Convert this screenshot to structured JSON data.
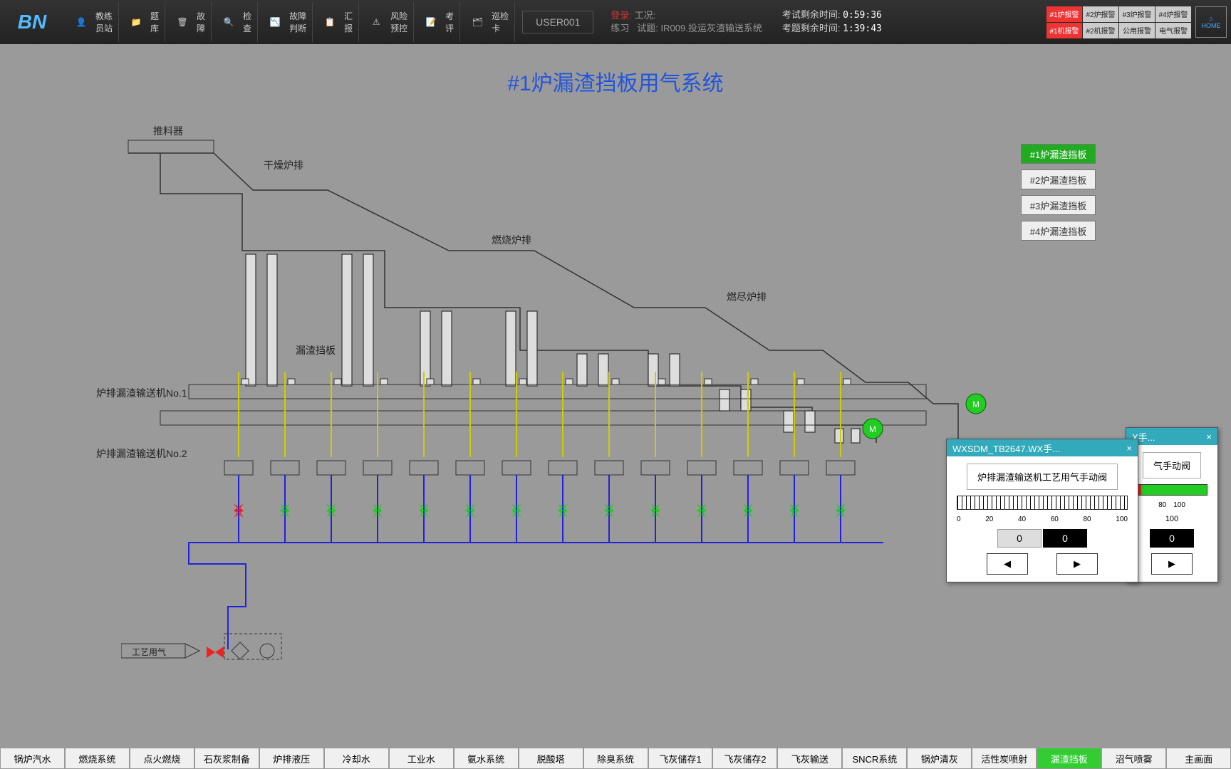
{
  "toolbar": {
    "logo": "BN",
    "buttons": [
      {
        "l1": "教练",
        "l2": "员站"
      },
      {
        "l1": "题",
        "l2": "库"
      },
      {
        "l1": "故",
        "l2": "障"
      },
      {
        "l1": "检",
        "l2": "查"
      },
      {
        "l1": "故障",
        "l2": "判断"
      },
      {
        "l1": "汇",
        "l2": "报"
      },
      {
        "l1": "风险",
        "l2": "预控"
      },
      {
        "l1": "考",
        "l2": "评"
      },
      {
        "l1": "巡检",
        "l2": "卡"
      }
    ],
    "user": "USER001",
    "info": {
      "line1_label": "登录:",
      "line1_val": "练习",
      "line2_label": "工况:",
      "line2_val": "",
      "line3_label": "试题:",
      "line3_val": "IR009.投运灰渣输送系统"
    },
    "timers": {
      "t1_label": "考试剩余时间:",
      "t1_val": "0:59:36",
      "t2_label": "考题剩余时间:",
      "t2_val": "1:39:43"
    },
    "alarms": [
      [
        "#1炉报警",
        "#2炉报警",
        "#3炉报警",
        "#4炉报警"
      ],
      [
        "#1机报警",
        "#2机报警",
        "公用报警",
        "电气报警"
      ]
    ],
    "alarm_red": [
      [
        true,
        false,
        false,
        false
      ],
      [
        true,
        false,
        false,
        false
      ]
    ],
    "home": "HOME"
  },
  "main": {
    "title": "#1炉漏渣挡板用气系统",
    "side_buttons": [
      {
        "label": "#1炉漏渣挡板",
        "active": true
      },
      {
        "label": "#2炉漏渣挡板",
        "active": false
      },
      {
        "label": "#3炉漏渣挡板",
        "active": false
      },
      {
        "label": "#4炉漏渣挡板",
        "active": false
      }
    ],
    "labels": {
      "pusher": "推料器",
      "dry_grate": "干燥炉排",
      "burn_grate": "燃烧炉排",
      "burnout_grate": "燃尽炉排",
      "slag_baffle": "漏渣挡板",
      "conveyor1": "炉排漏渣输送机No.1",
      "conveyor2": "炉排漏渣输送机No.2",
      "process_air": "工艺用气"
    }
  },
  "popup1": {
    "title": "WXSDM_TB2647.WX手...",
    "desc": "炉排漏渣输送机工艺用气手动阀",
    "scale": [
      "0",
      "20",
      "40",
      "60",
      "80",
      "100"
    ],
    "val_gray": "0",
    "val_black": "0"
  },
  "popup2": {
    "title": "X手...",
    "desc": "气手动阀",
    "scale": [
      "80",
      "100"
    ],
    "val_black": "0",
    "extra": "100"
  },
  "bottom_nav": [
    "锅炉汽水",
    "燃烧系统",
    "点火燃烧",
    "石灰浆制备",
    "炉排液压",
    "冷却水",
    "工业水",
    "氨水系统",
    "脱酸塔",
    "除臭系统",
    "飞灰储存1",
    "飞灰储存2",
    "飞灰输送",
    "SNCR系统",
    "锅炉清灰",
    "活性炭喷射",
    "漏渣挡板",
    "沼气喷雾",
    "主画面"
  ],
  "bottom_active_index": 16
}
